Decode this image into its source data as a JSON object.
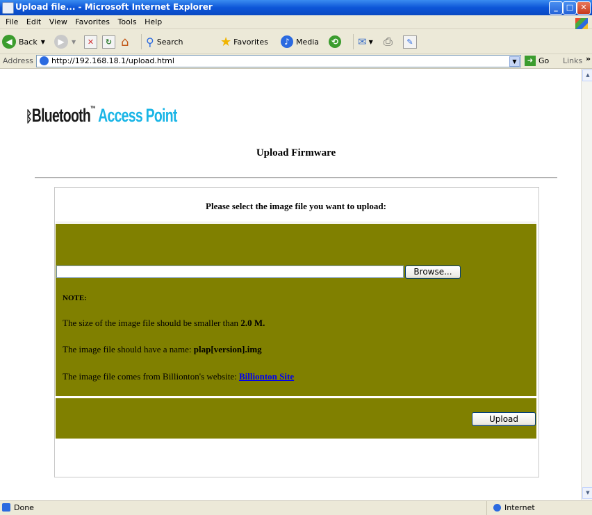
{
  "window": {
    "title": "Upload file... - Microsoft Internet Explorer"
  },
  "menu": [
    "File",
    "Edit",
    "View",
    "Favorites",
    "Tools",
    "Help"
  ],
  "toolbar": {
    "back": "Back",
    "search": "Search",
    "favorites": "Favorites",
    "media": "Media"
  },
  "address": {
    "label": "Address",
    "url": "http://192.168.18.1/upload.html",
    "go": "Go",
    "links": "Links"
  },
  "page": {
    "logo_bluetooth": "Bluetooth",
    "logo_tm": "™",
    "logo_access_point": "Access Point",
    "title": "Upload Firmware",
    "instruction": "Please select the image file you want to upload:",
    "browse_label": "Browse...",
    "note_label": "NOTE:",
    "size_text": "The size of the image file should be smaller than",
    "size_value": "2.0 M.",
    "name_text": "The image file should have a name:",
    "name_value": "plap[version].img",
    "source_text": "The image file comes from Billionton's website:",
    "source_link": "Billionton Site",
    "upload_label": "Upload"
  },
  "status": {
    "text": "Done",
    "zone": "Internet"
  },
  "colors": {
    "panel": "#808000",
    "link": "#0000ee",
    "logo_accent": "#19b5e6"
  }
}
